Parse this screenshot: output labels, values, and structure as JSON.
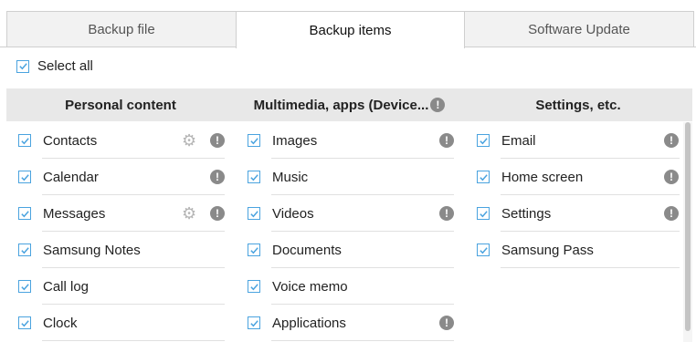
{
  "tabs": [
    {
      "label": "Backup file",
      "active": false
    },
    {
      "label": "Backup items",
      "active": true
    },
    {
      "label": "Software Update",
      "active": false
    }
  ],
  "select_all": {
    "label": "Select all",
    "checked": true
  },
  "columns": [
    {
      "header": "Personal content",
      "header_info": false,
      "items": [
        {
          "label": "Contacts",
          "checked": true,
          "gear": true,
          "info": true
        },
        {
          "label": "Calendar",
          "checked": true,
          "gear": false,
          "info": true
        },
        {
          "label": "Messages",
          "checked": true,
          "gear": true,
          "info": true
        },
        {
          "label": "Samsung Notes",
          "checked": true,
          "gear": false,
          "info": false
        },
        {
          "label": "Call log",
          "checked": true,
          "gear": false,
          "info": false
        },
        {
          "label": "Clock",
          "checked": true,
          "gear": false,
          "info": false
        }
      ]
    },
    {
      "header": "Multimedia, apps (Device...",
      "header_info": true,
      "items": [
        {
          "label": "Images",
          "checked": true,
          "gear": false,
          "info": true
        },
        {
          "label": "Music",
          "checked": true,
          "gear": false,
          "info": false
        },
        {
          "label": "Videos",
          "checked": true,
          "gear": false,
          "info": true
        },
        {
          "label": "Documents",
          "checked": true,
          "gear": false,
          "info": false
        },
        {
          "label": "Voice memo",
          "checked": true,
          "gear": false,
          "info": false
        },
        {
          "label": "Applications",
          "checked": true,
          "gear": false,
          "info": true
        }
      ]
    },
    {
      "header": "Settings, etc.",
      "header_info": false,
      "items": [
        {
          "label": "Email",
          "checked": true,
          "gear": false,
          "info": true
        },
        {
          "label": "Home screen",
          "checked": true,
          "gear": false,
          "info": true
        },
        {
          "label": "Settings",
          "checked": true,
          "gear": false,
          "info": true
        },
        {
          "label": "Samsung Pass",
          "checked": true,
          "gear": false,
          "info": false
        }
      ]
    }
  ],
  "colors": {
    "accent": "#4aa3df",
    "header_bg": "#e8e8e8",
    "info_icon": "#8a8a8a"
  }
}
